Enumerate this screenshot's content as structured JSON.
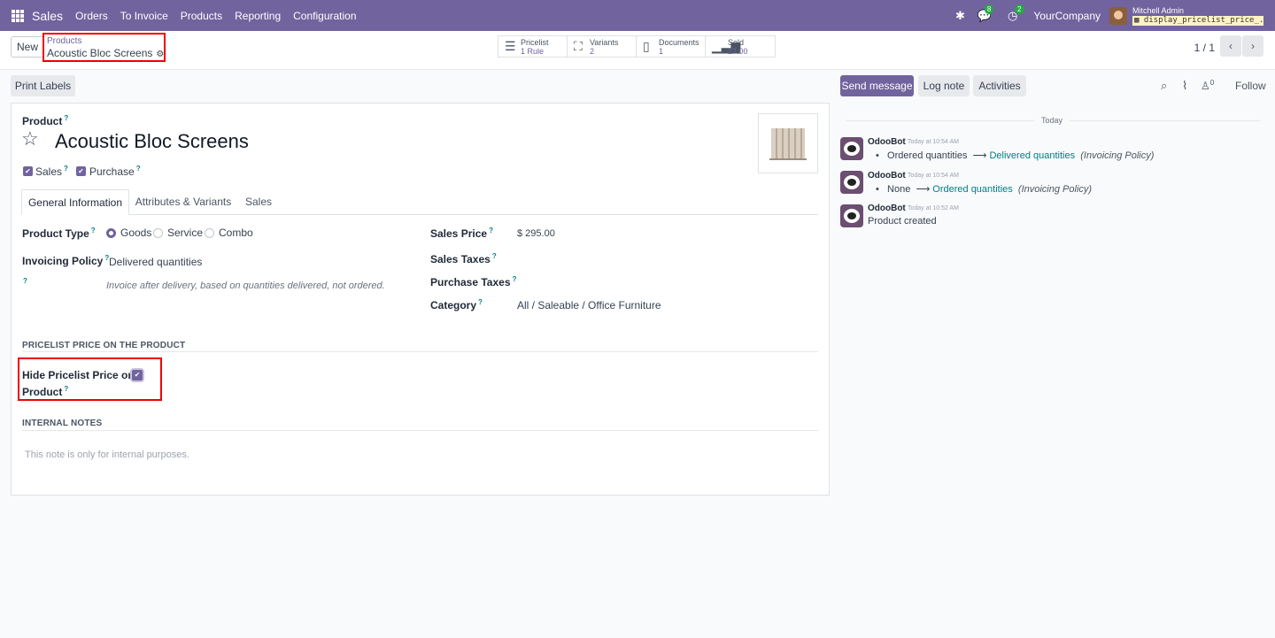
{
  "topbar": {
    "app_name": "Sales",
    "menu": [
      "Orders",
      "To Invoice",
      "Products",
      "Reporting",
      "Configuration"
    ],
    "messages_count": "8",
    "activities_count": "2",
    "company": "YourCompany",
    "user_name": "Mitchell Admin",
    "db_name": "display_pricelist_price_..."
  },
  "control": {
    "new_label": "New",
    "breadcrumb_parent": "Products",
    "breadcrumb_current": "Acoustic Bloc Screens",
    "smart_buttons": [
      {
        "label": "Pricelist",
        "value": "1 Rule",
        "icon": "list-icon"
      },
      {
        "label": "Variants",
        "value": "2",
        "icon": "sitemap-icon"
      },
      {
        "label": "Documents",
        "value": "1",
        "icon": "file-icon"
      },
      {
        "label": "Sold",
        "value": "27.00",
        "icon": "bar-chart-icon"
      }
    ],
    "pager": "1 / 1"
  },
  "actions": {
    "print_labels": "Print Labels"
  },
  "form": {
    "product_label": "Product",
    "product_name": "Acoustic Bloc Screens",
    "sales_label": "Sales",
    "purchase_label": "Purchase",
    "tabs": [
      "General Information",
      "Attributes & Variants",
      "Sales"
    ],
    "product_type_label": "Product Type",
    "product_type_options": [
      "Goods",
      "Service",
      "Combo"
    ],
    "product_type_selected": "Goods",
    "invoicing_policy_label": "Invoicing Policy",
    "invoicing_policy_value": "Delivered quantities",
    "invoicing_policy_hint": "Invoice after delivery, based on quantities delivered, not ordered.",
    "sales_price_label": "Sales Price",
    "sales_price_value": "$ 295.00",
    "sales_taxes_label": "Sales Taxes",
    "purchase_taxes_label": "Purchase Taxes",
    "category_label": "Category",
    "category_value": "All / Saleable / Office Furniture",
    "pricelist_section": "PRICELIST PRICE ON THE PRODUCT",
    "hide_pricelist_label_1": "Hide Pricelist Price on",
    "hide_pricelist_label_2": "Product",
    "hide_pricelist_checked": true,
    "internal_notes_section": "INTERNAL NOTES",
    "internal_notes_placeholder": "This note is only for internal purposes."
  },
  "chatter": {
    "send_message": "Send message",
    "log_note": "Log note",
    "activities": "Activities",
    "follow": "Follow",
    "followers_count": "0",
    "date_separator": "Today",
    "messages": [
      {
        "author": "OdooBot",
        "time": "Today at 10:54 AM",
        "old": "Ordered quantities",
        "new": "Delivered quantities",
        "field": "(Invoicing Policy)"
      },
      {
        "author": "OdooBot",
        "time": "Today at 10:54 AM",
        "old": "None",
        "new": "Ordered quantities",
        "field": "(Invoicing Policy)"
      },
      {
        "author": "OdooBot",
        "time": "Today at 10:52 AM",
        "body": "Product created"
      }
    ]
  },
  "colors": {
    "brand": "#71639e",
    "link": "#017e84",
    "highlight": "#e00000"
  }
}
